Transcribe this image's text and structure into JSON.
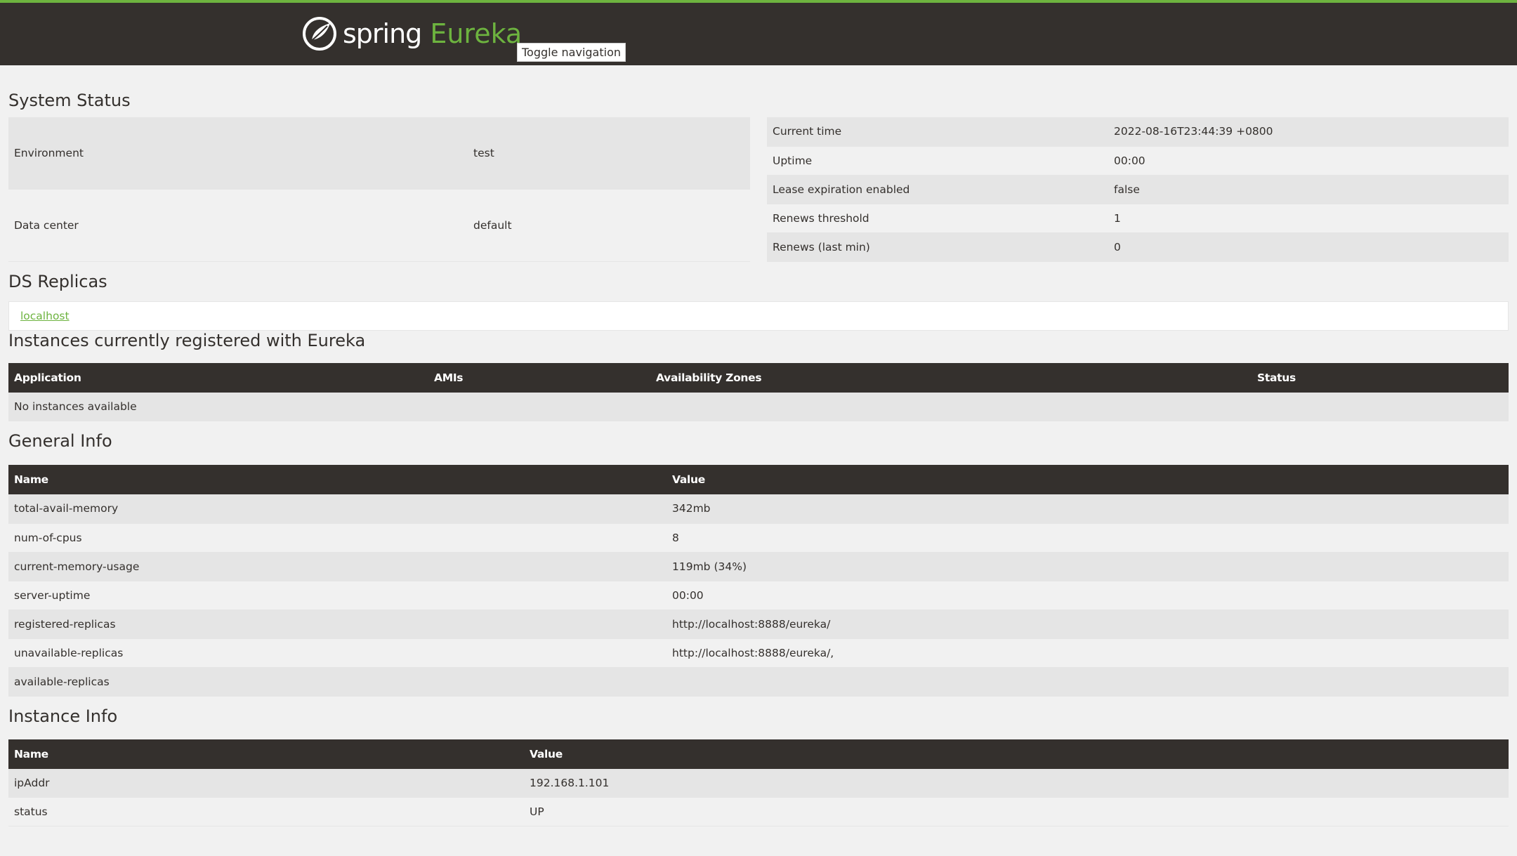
{
  "navbar": {
    "brand_spring": "spring",
    "brand_eureka": "Eureka",
    "toggle_label": "Toggle navigation"
  },
  "system_status": {
    "title": "System Status",
    "left": [
      {
        "key": "Environment",
        "value": "test"
      },
      {
        "key": "Data center",
        "value": "default"
      }
    ],
    "right": [
      {
        "key": "Current time",
        "value": "2022-08-16T23:44:39 +0800"
      },
      {
        "key": "Uptime",
        "value": "00:00"
      },
      {
        "key": "Lease expiration enabled",
        "value": "false"
      },
      {
        "key": "Renews threshold",
        "value": "1"
      },
      {
        "key": "Renews (last min)",
        "value": "0"
      }
    ]
  },
  "ds_replicas": {
    "title": "DS Replicas",
    "link": "localhost"
  },
  "instances": {
    "title": "Instances currently registered with Eureka",
    "headers": [
      "Application",
      "AMIs",
      "Availability Zones",
      "Status"
    ],
    "empty_message": "No instances available"
  },
  "general_info": {
    "title": "General Info",
    "headers": [
      "Name",
      "Value"
    ],
    "rows": [
      {
        "name": "total-avail-memory",
        "value": "342mb"
      },
      {
        "name": "num-of-cpus",
        "value": "8"
      },
      {
        "name": "current-memory-usage",
        "value": "119mb (34%)"
      },
      {
        "name": "server-uptime",
        "value": "00:00"
      },
      {
        "name": "registered-replicas",
        "value": "http://localhost:8888/eureka/"
      },
      {
        "name": "unavailable-replicas",
        "value": "http://localhost:8888/eureka/,"
      },
      {
        "name": "available-replicas",
        "value": ""
      }
    ]
  },
  "instance_info": {
    "title": "Instance Info",
    "headers": [
      "Name",
      "Value"
    ],
    "rows": [
      {
        "name": "ipAddr",
        "value": "192.168.1.101"
      },
      {
        "name": "status",
        "value": "UP"
      }
    ]
  },
  "colors": {
    "brand_green": "#6db33f",
    "header_dark": "#34302d",
    "stripe": "#e5e5e5",
    "background": "#f1f1f1"
  }
}
